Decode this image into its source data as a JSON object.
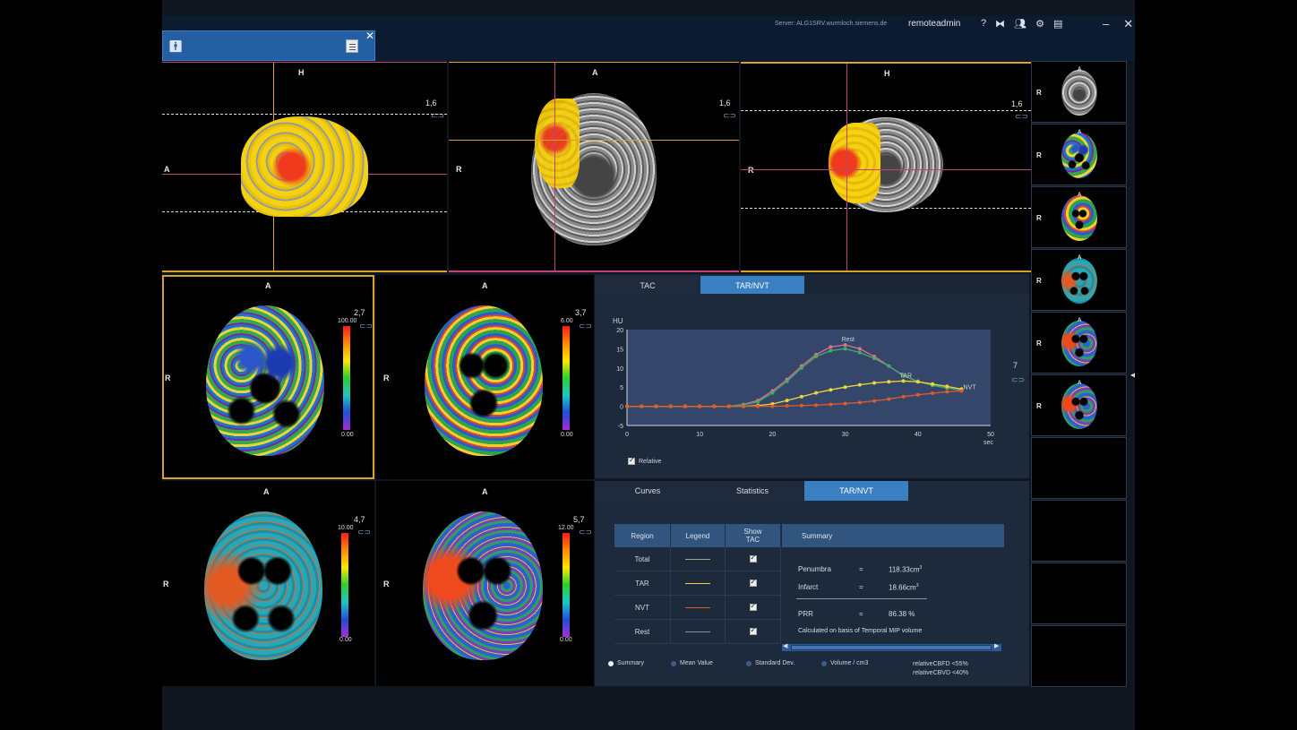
{
  "titlebar": {
    "server": "Server: ALG1SRV.wurmloch.siemens.de",
    "user": "remoteadmin",
    "icons": [
      "help-icon",
      "layout-icon",
      "users-icon",
      "gear-icon",
      "toolbox-icon"
    ],
    "help_glyph": "?",
    "minimize_glyph": "–",
    "close_glyph": "✕"
  },
  "patient_tab": {
    "close_glyph": "✕"
  },
  "top_views": [
    {
      "top": "H",
      "left": "A",
      "value": "1,6"
    },
    {
      "top": "A",
      "left": "R",
      "value": "1,6"
    },
    {
      "top": "H",
      "left": "R",
      "value": "1,6"
    }
  ],
  "maps": [
    {
      "top": "A",
      "left": "R",
      "value": "2,7",
      "max": "100.00",
      "min": "0.00"
    },
    {
      "top": "A",
      "left": "R",
      "value": "3,7",
      "max": "6.00",
      "min": "0.00"
    },
    {
      "top": "A",
      "left": "R",
      "value": "4,7",
      "max": "10.00",
      "min": "0.00"
    },
    {
      "top": "A",
      "left": "R",
      "value": "5,7",
      "max": "12.00",
      "min": "0.00"
    }
  ],
  "chart_tabs": [
    {
      "label": "TAC",
      "active": false
    },
    {
      "label": "TAR/NVT",
      "active": true
    }
  ],
  "chart_side_value": "7",
  "relative_label": "Relative",
  "chart_data": {
    "type": "line",
    "ylabel": "HU",
    "xlabel": "sec",
    "xlim": [
      0,
      50
    ],
    "ylim": [
      -5,
      20
    ],
    "xticks": [
      0,
      10,
      20,
      30,
      40,
      50
    ],
    "yticks": [
      -5,
      0,
      5,
      10,
      15,
      20
    ],
    "grid": false,
    "series": [
      {
        "name": "Rest",
        "color": "#e06e8a",
        "x": [
          0,
          2,
          4,
          6,
          8,
          10,
          12,
          14,
          16,
          18,
          20,
          22,
          24,
          26,
          28,
          30,
          32,
          34,
          36,
          38,
          40,
          42,
          44,
          46
        ],
        "y": [
          0,
          0,
          0,
          0,
          0,
          0,
          0,
          0,
          0.5,
          1.5,
          4,
          7,
          10.5,
          13.5,
          15.5,
          16,
          15,
          13,
          10.5,
          8,
          6.5,
          5.5,
          4.8,
          4.2
        ]
      },
      {
        "name": "",
        "color": "#3fae6a",
        "x": [
          0,
          2,
          4,
          6,
          8,
          10,
          12,
          14,
          16,
          18,
          20,
          22,
          24,
          26,
          28,
          30,
          32,
          34,
          36,
          38,
          40,
          42,
          44,
          46
        ],
        "y": [
          0,
          0,
          0,
          0,
          0,
          0,
          0,
          0,
          0.4,
          1.2,
          3.5,
          6.5,
          10,
          13,
          14.5,
          15,
          14,
          12.5,
          10.5,
          8,
          6.5,
          5.5,
          4.8,
          4.2
        ]
      },
      {
        "name": "TAR",
        "color": "#f0d43a",
        "x": [
          0,
          2,
          4,
          6,
          8,
          10,
          12,
          14,
          16,
          18,
          20,
          22,
          24,
          26,
          28,
          30,
          32,
          34,
          36,
          38,
          40,
          42,
          44,
          46
        ],
        "y": [
          0,
          0,
          0,
          0,
          0,
          0,
          0,
          0,
          0,
          0.2,
          0.6,
          1.5,
          2.5,
          3.5,
          4.3,
          5,
          5.6,
          6.1,
          6.4,
          6.6,
          6.4,
          5.8,
          5.2,
          4.5
        ]
      },
      {
        "name": "NVT",
        "color": "#e05a2a",
        "x": [
          0,
          2,
          4,
          6,
          8,
          10,
          12,
          14,
          16,
          18,
          20,
          22,
          24,
          26,
          28,
          30,
          32,
          34,
          36,
          38,
          40,
          42,
          44,
          46
        ],
        "y": [
          0,
          0,
          0,
          0,
          0,
          0,
          0,
          0,
          0,
          0,
          0,
          0.1,
          0.2,
          0.3,
          0.5,
          0.7,
          1,
          1.4,
          1.9,
          2.5,
          3,
          3.4,
          3.8,
          4
        ]
      }
    ]
  },
  "stats_tabs": [
    {
      "label": "Curves",
      "active": false
    },
    {
      "label": "Statistics",
      "active": false
    },
    {
      "label": "TAR/NVT",
      "active": true
    }
  ],
  "table": {
    "headers": [
      "Region",
      "Legend",
      "Show TAC",
      "Summary"
    ],
    "rows": [
      {
        "region": "Total",
        "color": "#8fae8f"
      },
      {
        "region": "TAR",
        "color": "#f0d43a"
      },
      {
        "region": "NVT",
        "color": "#e05a2a"
      },
      {
        "region": "Rest",
        "color": "#7a8fb8"
      }
    ]
  },
  "summary": {
    "penumbra_label": "Penumbra",
    "penumbra_eq": "=",
    "penumbra_value": "118.33cm",
    "penumbra_exp": "3",
    "infarct_label": "Infarct",
    "infarct_eq": "=",
    "infarct_value": "18.66cm",
    "infarct_exp": "3",
    "prr_label": "PRR",
    "prr_eq": "=",
    "prr_value": "86.38 %",
    "note": "Calculated on basis of Temporal MIP volume"
  },
  "radio_options": [
    {
      "label": "Summary",
      "selected": true
    },
    {
      "label": "Mean Value",
      "selected": false
    },
    {
      "label": "Standard Dev.",
      "selected": false
    },
    {
      "label": "Volume / cm3",
      "selected": false
    }
  ],
  "thresholds": [
    "relativeCBFD <55%",
    "relativeCBVD <40%"
  ],
  "thumbnails": [
    {
      "orient": "R",
      "top": "A",
      "kind": "ct"
    },
    {
      "orient": "R",
      "top": "A",
      "kind": "perf1"
    },
    {
      "orient": "R",
      "top": "A",
      "kind": "perf2"
    },
    {
      "orient": "R",
      "top": "A",
      "kind": "perf3"
    },
    {
      "orient": "R",
      "top": "A",
      "kind": "perf4"
    },
    {
      "orient": "R",
      "top": "A",
      "kind": "perf4"
    }
  ]
}
